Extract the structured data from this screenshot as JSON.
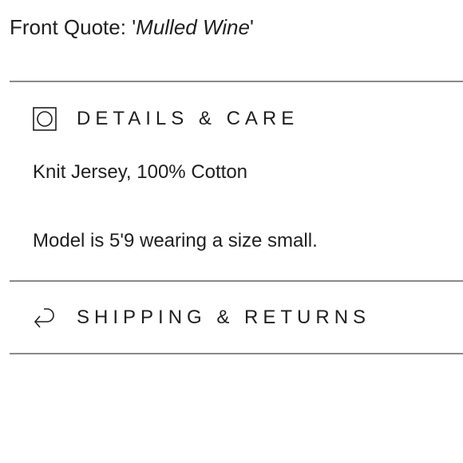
{
  "product": {
    "quote_prefix": "Front Quote: ",
    "quote_open": "'",
    "quote_text": "Mulled Wine",
    "quote_close": "'"
  },
  "details_care": {
    "title": "DETAILS & CARE",
    "icon": "washing-care-icon",
    "material": "Knit Jersey, 100% Cotton",
    "model_info": "Model is 5'9 wearing a size small."
  },
  "shipping_returns": {
    "title": "SHIPPING & RETURNS",
    "icon": "return-arrow-icon"
  }
}
